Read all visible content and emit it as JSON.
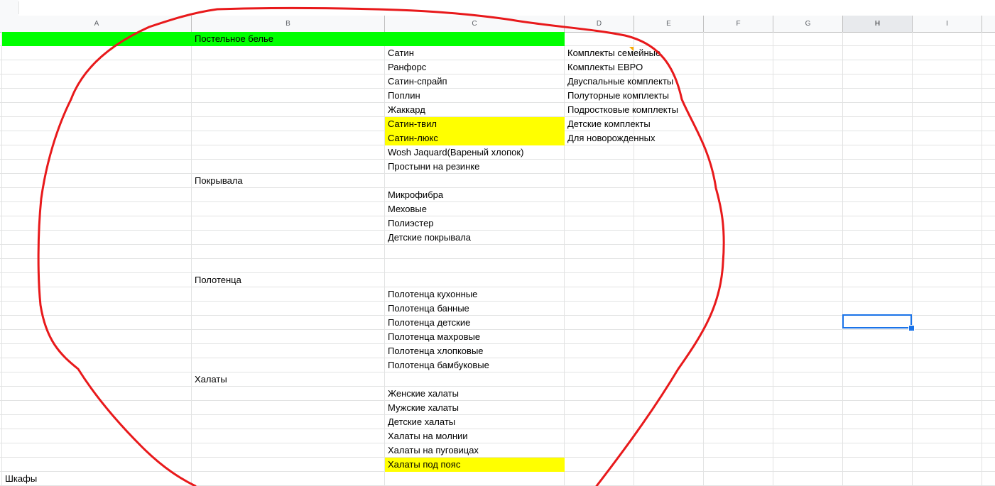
{
  "columns": [
    "A",
    "B",
    "C",
    "D",
    "E",
    "F",
    "G",
    "H",
    "I"
  ],
  "selected_column": "H",
  "rows": [
    {
      "b": "Постельное белье",
      "highlight_ab": "green"
    },
    {
      "c": "Сатин",
      "d": "Комплекты семейные"
    },
    {
      "c": "Ранфорс",
      "d": "Комплекты ЕВРО"
    },
    {
      "c": "Сатин-спрайп",
      "d": "Двуспальные комплекты"
    },
    {
      "c": "Поплин",
      "d": "Полуторные комплекты"
    },
    {
      "c": "Жаккард",
      "d": "Подростковые комплекты"
    },
    {
      "c": "Сатин-твил",
      "d": "Детские комплекты",
      "highlight_c": "yellow"
    },
    {
      "c": "Сатин-люкс",
      "d": "Для новорожденных",
      "highlight_c": "yellow"
    },
    {
      "c": "Wosh Jaquard(Вареный хлопок)"
    },
    {
      "c": "Простыни на резинке"
    },
    {
      "b": "Покрывала"
    },
    {
      "c": "Микрофибра"
    },
    {
      "c": "Меховые"
    },
    {
      "c": "Полиэстер"
    },
    {
      "c": "Детские покрывала"
    },
    {},
    {},
    {
      "b": "Полотенца"
    },
    {
      "c": "Полотенца кухонные"
    },
    {
      "c": "Полотенца банные"
    },
    {
      "c": "Полотенца детские"
    },
    {
      "c": "Полотенца махровые"
    },
    {
      "c": "Полотенца хлопковые"
    },
    {
      "c": "Полотенца бамбуковые"
    },
    {
      "b": "Халаты"
    },
    {
      "c": "Женские халаты"
    },
    {
      "c": "Мужские халаты"
    },
    {
      "c": "Детские халаты"
    },
    {
      "c": "Халаты на молнии"
    },
    {
      "c": "Халаты на пуговицах"
    },
    {
      "c": "Халаты под пояс",
      "highlight_c": "yellow"
    },
    {
      "a": "Шкафы"
    }
  ],
  "colors": {
    "green": "#00ff00",
    "yellow": "#ffff00",
    "selection": "#1a73e8",
    "annotation": "#e8191b"
  },
  "annotation": "red-freehand-circle"
}
